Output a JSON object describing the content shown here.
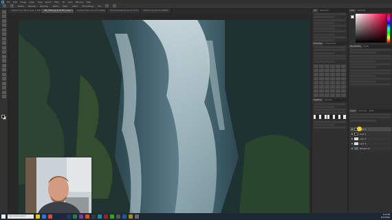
{
  "app": {
    "logo": "Ps"
  },
  "menu": [
    "File",
    "Edit",
    "Image",
    "Layer",
    "Type",
    "Select",
    "Filter",
    "3D",
    "View",
    "Window",
    "Help"
  ],
  "options_bar": {
    "mode_label": "Mode:",
    "mode_value": "Normal",
    "opacity_label": "Opacity:",
    "opacity_value": "100%",
    "flow_label": "Flow:",
    "flow_value": "100%",
    "smoothing_label": "Smoothing:",
    "smoothing_value": "0%"
  },
  "tabs": [
    {
      "label": "Untitled-1 @ 100% (Layer 1, RGB/8) *"
    },
    {
      "label": "IMG_5603.jpg @ 25.6% (Layer 1, Layer Mask/8) *"
    },
    {
      "label": "Gradient Map 1 @ 25% (RGB/8)"
    },
    {
      "label": "PhotoshopTutorial.psd @ 33.3% (Layer 1, RGB/8)"
    },
    {
      "label": "Untitled-2 @ 66.7% (RGB/8)"
    }
  ],
  "panels": {
    "col_a_top_tabs": [
      "Info",
      "Histogram"
    ],
    "col_a_mid_tabs": [
      "Properties",
      "Adjustments"
    ],
    "col_a_low_tabs": [
      "Swatches",
      "Libraries"
    ],
    "col_b_top_tabs": [
      "Color",
      "Swatches"
    ],
    "col_b_mid_tabs": [
      "Adjustments",
      "Styles"
    ],
    "col_b_layer_tabs": [
      "Layers",
      "Channels",
      "Paths"
    ]
  },
  "layers": [
    {
      "name": "Layer 1"
    },
    {
      "name": "Layer 2"
    },
    {
      "name": "Layer 3"
    },
    {
      "name": "Layer 4"
    },
    {
      "name": "Background"
    }
  ],
  "taskbar": {
    "search_placeholder": "Type here to search",
    "time": "3:22 PM",
    "date": "10/7/2019"
  },
  "colors": {
    "foreground": "#111111",
    "background": "#ffffff",
    "accent": "#31a8ff",
    "cursor_highlight": "#f2d23a"
  },
  "icons": [
    "move-tool-icon",
    "marquee-tool-icon",
    "lasso-tool-icon",
    "brush-tool-icon",
    "eraser-tool-icon",
    "zoom-tool-icon",
    "windows-start-icon"
  ]
}
